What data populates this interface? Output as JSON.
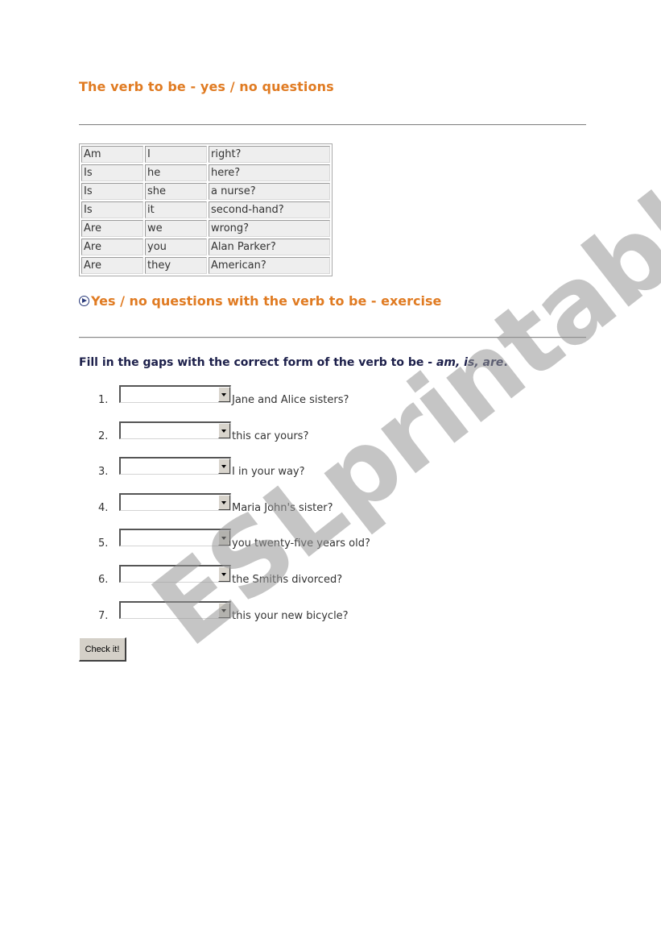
{
  "header": {
    "title": "The verb to be - yes / no questions"
  },
  "table": {
    "rows": [
      [
        "Am",
        "I",
        "right?"
      ],
      [
        "Is",
        "he",
        "here?"
      ],
      [
        "Is",
        "she",
        "a nurse?"
      ],
      [
        "Is",
        "it",
        "second-hand?"
      ],
      [
        "Are",
        "we",
        "wrong?"
      ],
      [
        "Are",
        "you",
        "Alan Parker?"
      ],
      [
        "Are",
        "they",
        "American?"
      ]
    ]
  },
  "exercise": {
    "icon": "play-circle-icon",
    "title": "Yes / no questions with the verb to be - exercise",
    "instructions_prefix": "Fill in the gaps with the correct form of the verb to be - ",
    "instructions_options": "am, is, are",
    "instructions_suffix": ".",
    "questions": [
      {
        "number": "1.",
        "selected": "",
        "text": "Jane and Alice sisters?"
      },
      {
        "number": "2.",
        "selected": "",
        "text": "this car yours?"
      },
      {
        "number": "3.",
        "selected": "",
        "text": "I in your way?"
      },
      {
        "number": "4.",
        "selected": "",
        "text": "Maria John's sister?"
      },
      {
        "number": "5.",
        "selected": "",
        "text": "you twenty-five years old?"
      },
      {
        "number": "6.",
        "selected": "",
        "text": "the Smiths divorced?"
      },
      {
        "number": "7.",
        "selected": "",
        "text": "this your new bicycle?"
      }
    ],
    "check_button_label": "Check it!"
  },
  "watermark": {
    "text": "ESLprintables.com"
  },
  "colors": {
    "heading_orange": "#e07b22",
    "instruction_navy": "#1c1f4a",
    "body_text": "#333333",
    "table_cell_bg": "#eeeeee",
    "watermark_gray": "#969696"
  }
}
